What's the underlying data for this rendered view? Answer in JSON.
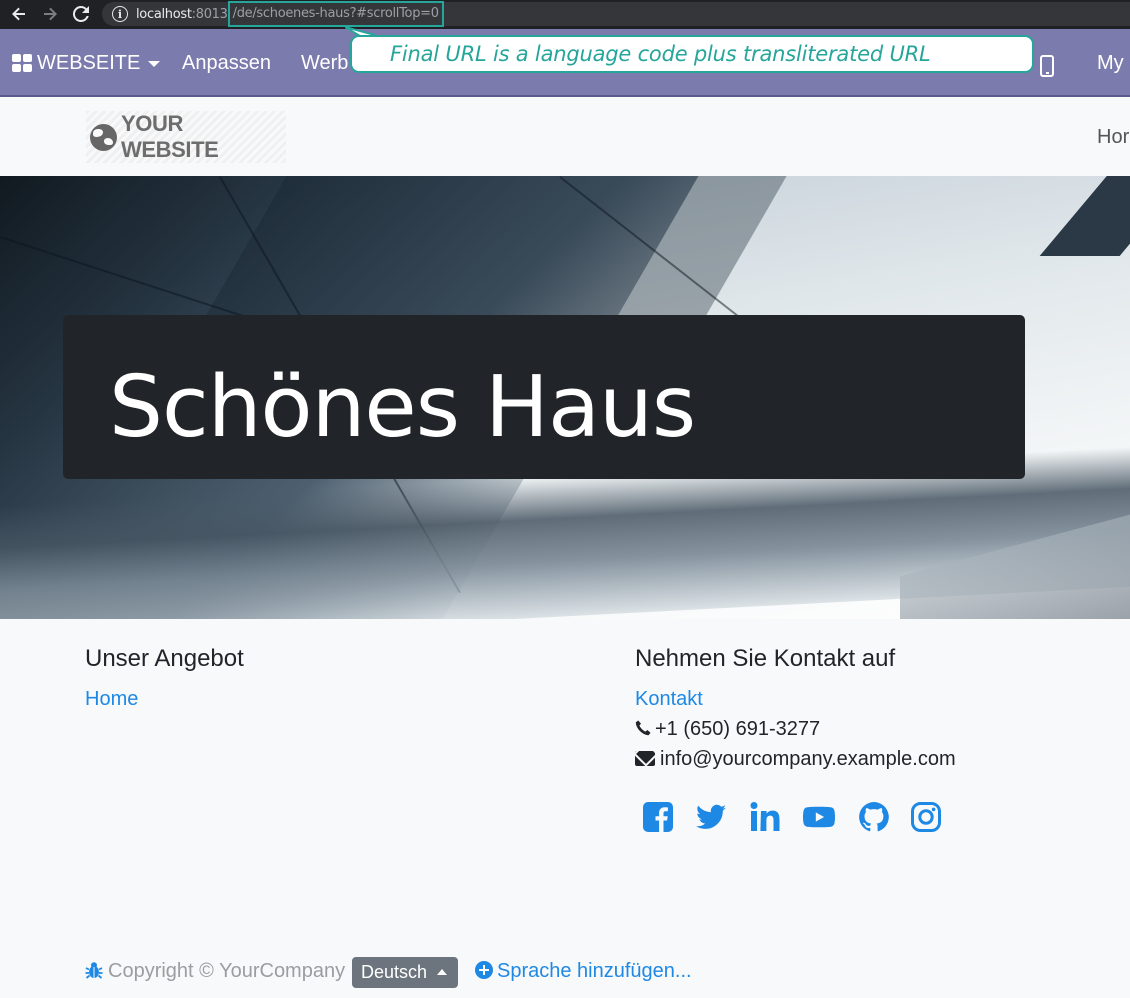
{
  "browser": {
    "url_host": "localhost",
    "url_port": ":8013",
    "url_path": "/de/schoenes-haus?#scrollTop=0"
  },
  "callout": {
    "text": "Final URL is a language code plus transliterated URL"
  },
  "topbar": {
    "app_menu": "WEBSEITE",
    "items": [
      "Anpassen",
      "Werb"
    ],
    "right_text": "My"
  },
  "site": {
    "logo_text": "YOUR WEBSITE",
    "nav_home": "Hor"
  },
  "hero": {
    "title": "Schönes Haus"
  },
  "footer": {
    "left": {
      "title": "Unser Angebot",
      "link": "Home"
    },
    "right": {
      "title": "Nehmen Sie Kontakt auf",
      "link": "Kontakt",
      "phone": "+1 (650) 691-3277",
      "email": "info@yourcompany.example.com"
    },
    "social_icons": [
      "facebook-icon",
      "twitter-icon",
      "linkedin-icon",
      "youtube-icon",
      "github-icon",
      "instagram-icon"
    ],
    "copyright": "Copyright © YourCompany",
    "language": "Deutsch",
    "add_language": "Sprache hinzufügen..."
  },
  "colors": {
    "topbar": "#7c7bad",
    "accent_callout": "#26a59a",
    "link": "#1e88e5",
    "hero_box": "#212529"
  }
}
